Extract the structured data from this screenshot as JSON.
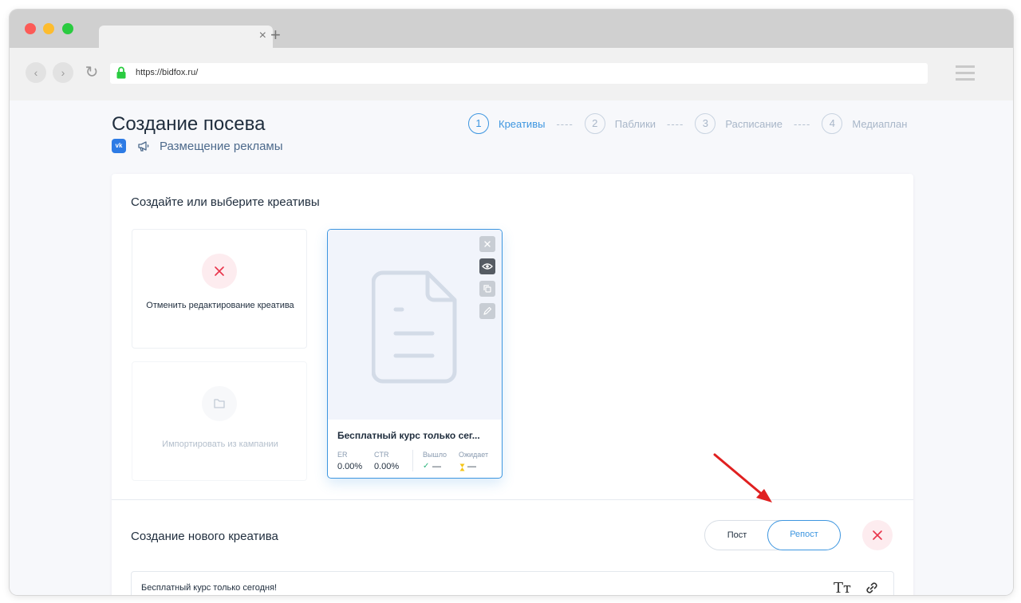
{
  "browser": {
    "url": "https://bidfox.ru/",
    "tab_close": "×",
    "tab_new": "+",
    "back": "‹",
    "forward": "›",
    "reload": "↻"
  },
  "page": {
    "title": "Создание посева",
    "vk_label": "vk",
    "subtitle": "Размещение рекламы"
  },
  "steps": [
    {
      "num": "1",
      "label": "Креативы",
      "active": true
    },
    {
      "num": "2",
      "label": "Паблики",
      "active": false
    },
    {
      "num": "3",
      "label": "Расписание",
      "active": false
    },
    {
      "num": "4",
      "label": "Медиаплан",
      "active": false
    }
  ],
  "step_separator": "----",
  "creatives_section": {
    "heading": "Создайте или выберите креативы",
    "cancel_tile_label": "Отменить редактирование креатива",
    "import_tile_label": "Импортировать из кампании"
  },
  "creative_card": {
    "title": "Бесплатный курс только сег...",
    "stats": [
      {
        "label": "ER",
        "value": "0.00%"
      },
      {
        "label": "CTR",
        "value": "0.00%"
      },
      {
        "label": "Вышло",
        "value": "—"
      },
      {
        "label": "Ожидает",
        "value": "—"
      }
    ],
    "side_buttons": [
      "close-icon",
      "eye-icon",
      "copy-icon",
      "pencil-icon"
    ]
  },
  "new_creative": {
    "heading": "Создание нового креатива",
    "toggle_post": "Пост",
    "toggle_repost": "Репост",
    "toggle_selected": "Репост",
    "text_value": "Бесплатный курс только сегодня!",
    "format_label": "Tт"
  },
  "colors": {
    "accent": "#3d96e0",
    "danger": "#e8334a",
    "annotation_arrow": "#e02020"
  }
}
